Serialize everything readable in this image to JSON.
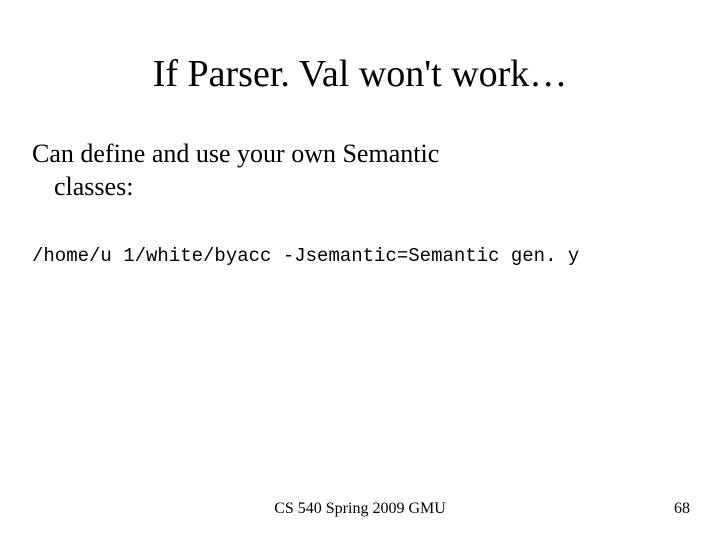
{
  "slide": {
    "title": "If Parser. Val won't work…",
    "body_line1": "Can define and use your own Semantic",
    "body_line2": "classes:",
    "code": "/home/u 1/white/byacc -Jsemantic=Semantic gen. y",
    "footer_center": "CS 540 Spring 2009 GMU",
    "footer_page": "68"
  }
}
